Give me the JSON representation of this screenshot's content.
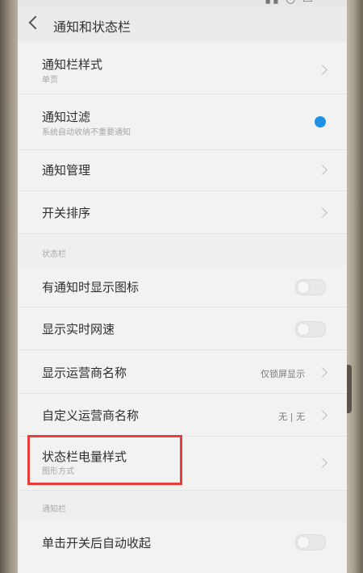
{
  "header": {
    "title": "通知和状态栏"
  },
  "colors": {
    "accent": "#1e90e6",
    "highlight": "#ec3b3b"
  },
  "icons": {
    "back": "back-arrow-icon",
    "chevron": "chevron-right-icon"
  },
  "rows": {
    "notif_style": {
      "title": "通知栏样式",
      "subtitle": "单页"
    },
    "notif_filter": {
      "title": "通知过滤",
      "subtitle": "系统自动收纳不重要通知",
      "toggle_on": true
    },
    "notif_manage": {
      "title": "通知管理"
    },
    "switch_order": {
      "title": "开关排序"
    },
    "show_icon": {
      "title": "有通知时显示图标",
      "toggle_on": false
    },
    "show_speed": {
      "title": "显示实时网速",
      "toggle_on": false
    },
    "carrier_name": {
      "title": "显示运营商名称",
      "value": "仅锁屏显示"
    },
    "custom_carrier": {
      "title": "自定义运营商名称",
      "value": "无 | 无"
    },
    "battery_style": {
      "title": "状态栏电量样式",
      "subtitle": "图形方式"
    },
    "auto_collapse": {
      "title": "单击开关后自动收起",
      "toggle_on": false
    }
  },
  "sections": {
    "status_bar": "状态栏",
    "notif_bar": "通知栏"
  }
}
